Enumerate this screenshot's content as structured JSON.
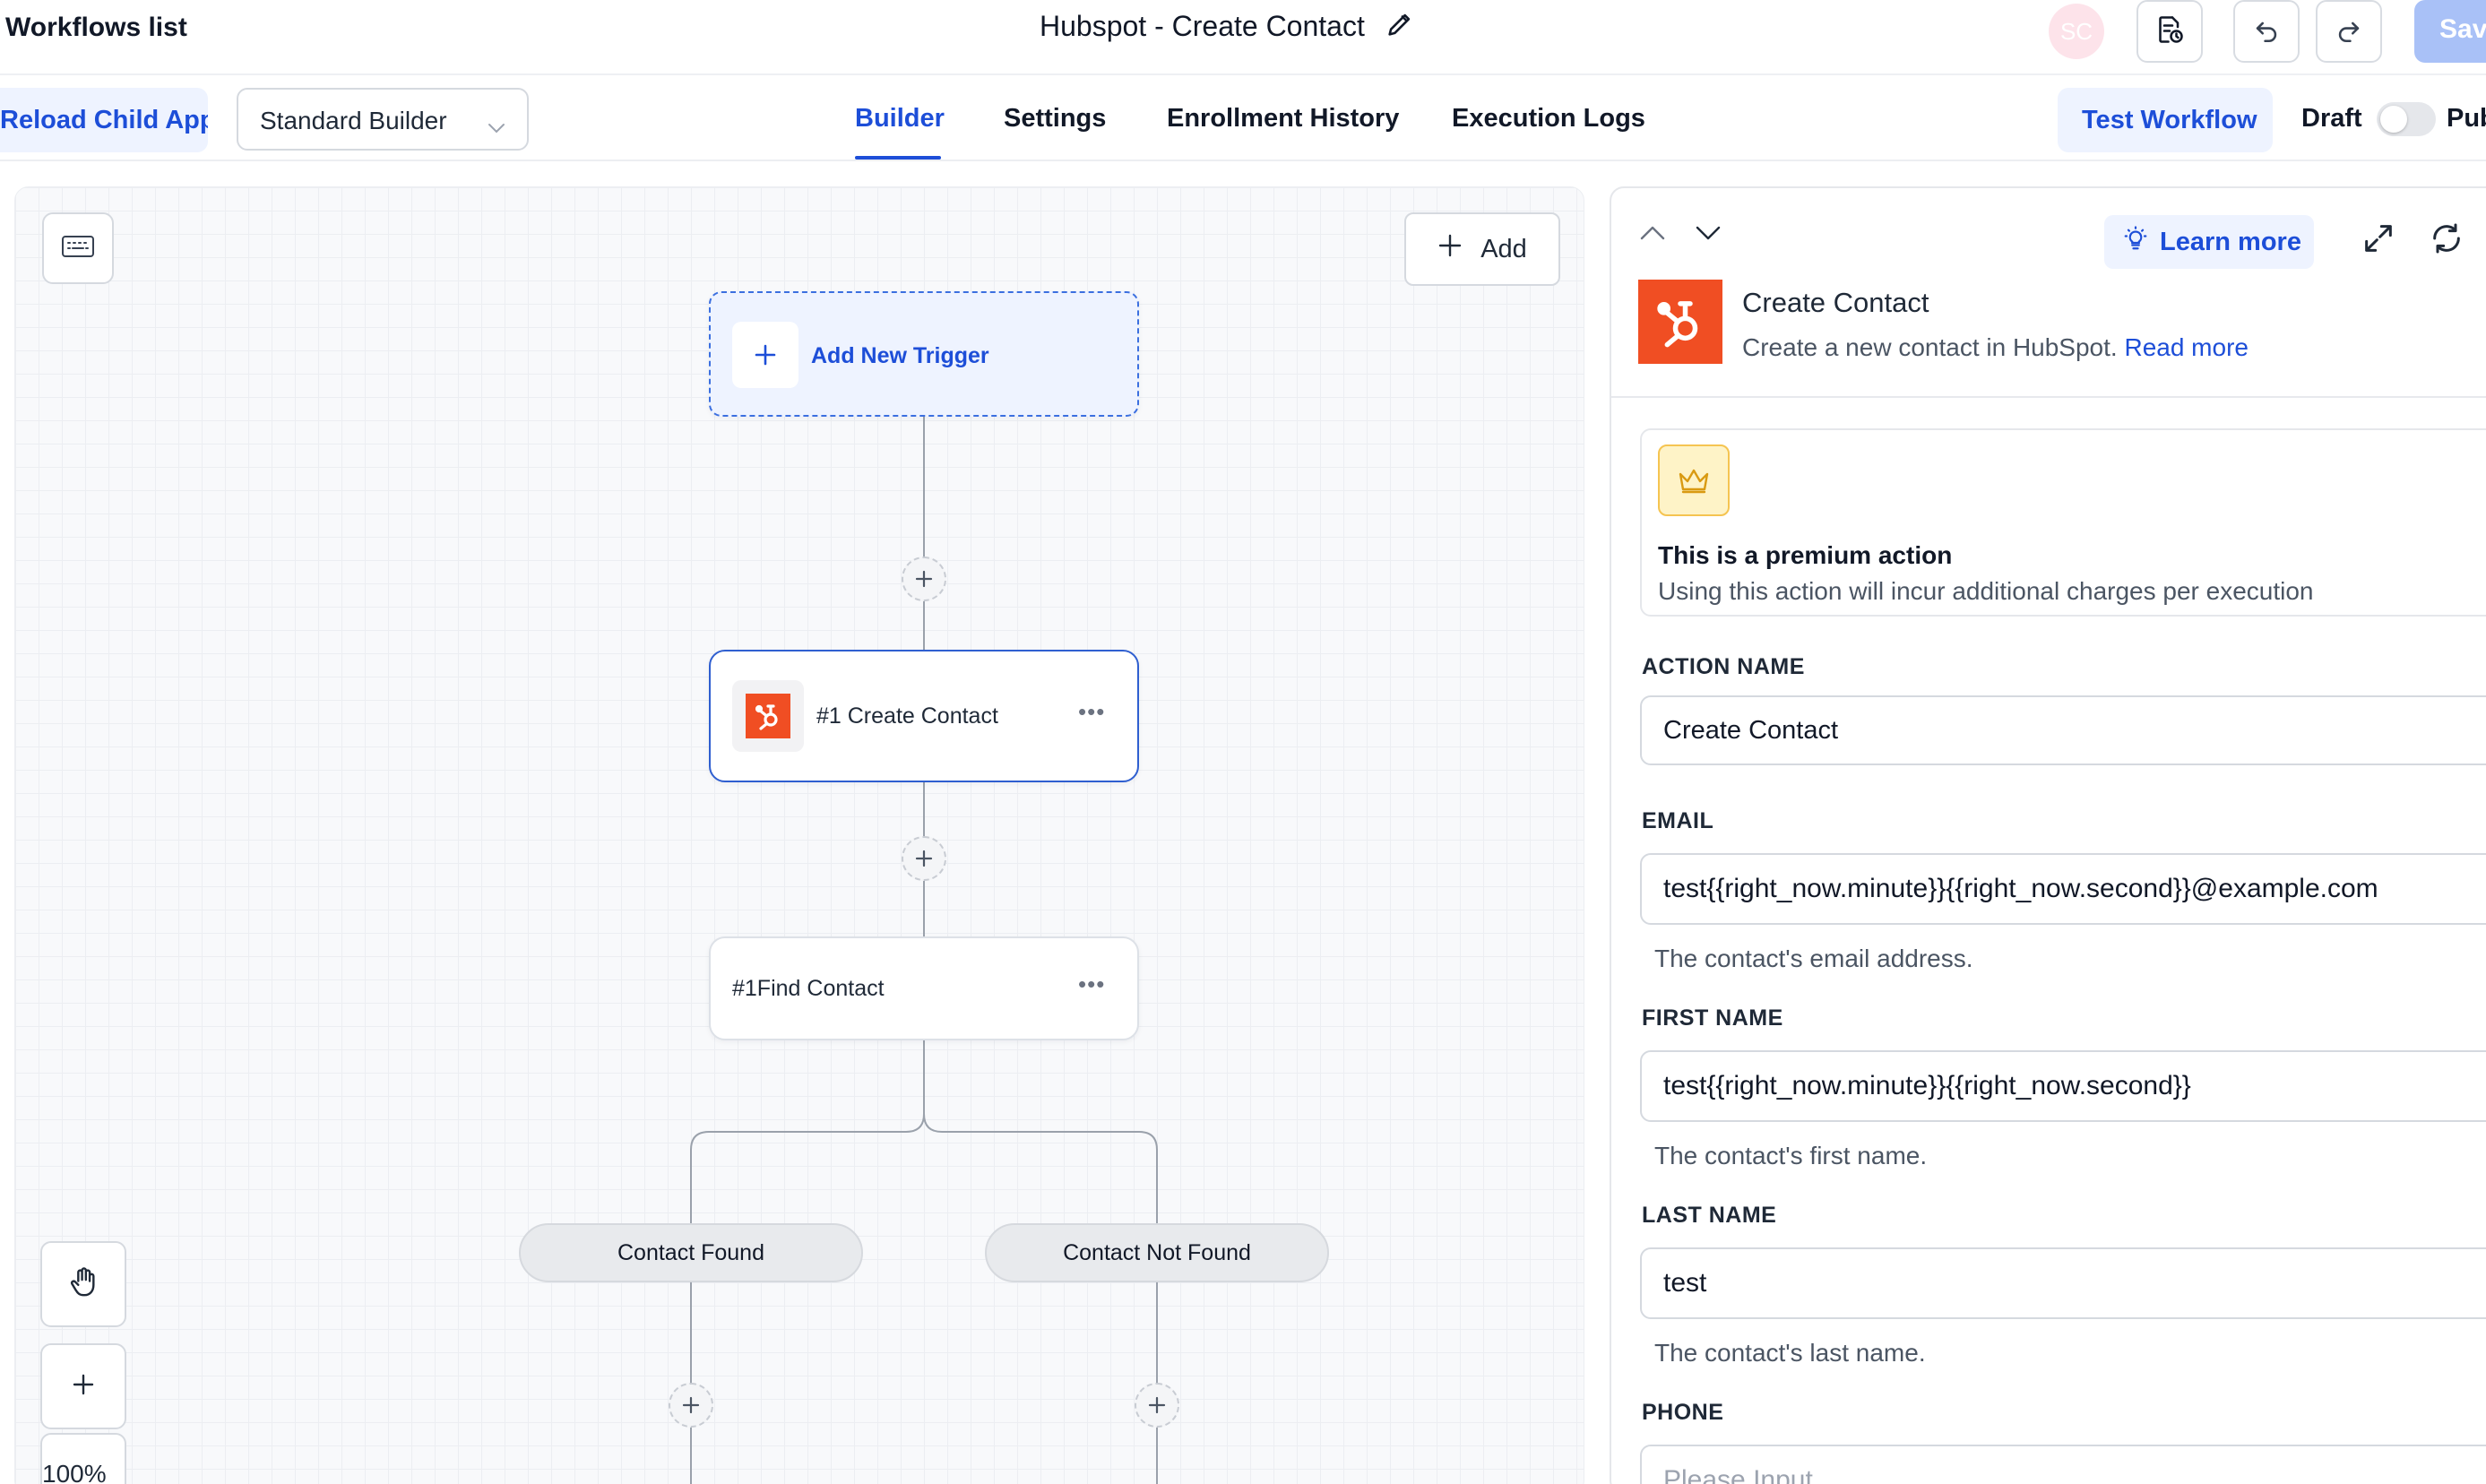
{
  "topbar": {
    "back_label": "Workflows list",
    "title": "Hubspot - Create Contact",
    "avatar_initials": "SC",
    "save_label": "Save"
  },
  "navbar": {
    "reload_label": "Reload Child App",
    "builder_select": "Standard Builder",
    "tabs": [
      {
        "label": "Builder",
        "active": true
      },
      {
        "label": "Settings",
        "active": false
      },
      {
        "label": "Enrollment History",
        "active": false
      },
      {
        "label": "Execution Logs",
        "active": false
      }
    ],
    "test_label": "Test Workflow",
    "draft_label": "Draft",
    "publish_label": "Publish",
    "publish_on": false
  },
  "canvas": {
    "add_label": "Add",
    "trigger_label": "Add New Trigger",
    "create_node_label": "#1 Create Contact",
    "find_node_label": "#1Find Contact",
    "branch_found": "Contact Found",
    "branch_not_found": "Contact Not Found",
    "zoom": "100%"
  },
  "panel": {
    "learn_more": "Learn more",
    "title": "Create Contact",
    "description": "Create a new contact in HubSpot.",
    "read_more": "Read more",
    "premium_title": "This is a premium action",
    "premium_text": "Using this action will incur additional charges per execution",
    "fields": {
      "action_name": {
        "label": "ACTION NAME",
        "value": "Create Contact"
      },
      "email": {
        "label": "EMAIL",
        "value": "test{{right_now.minute}}{{right_now.second}}@example.com",
        "help": "The contact's email address."
      },
      "first_name": {
        "label": "FIRST NAME",
        "value": "test{{right_now.minute}}{{right_now.second}}",
        "help": "The contact's first name."
      },
      "last_name": {
        "label": "LAST NAME",
        "value": "test",
        "help": "The contact's last name."
      },
      "phone": {
        "label": "PHONE",
        "placeholder": "Please Input"
      }
    }
  },
  "colors": {
    "accent": "#1d4ed8",
    "hubspot": "#f04e23",
    "premium": "#f5c451"
  }
}
